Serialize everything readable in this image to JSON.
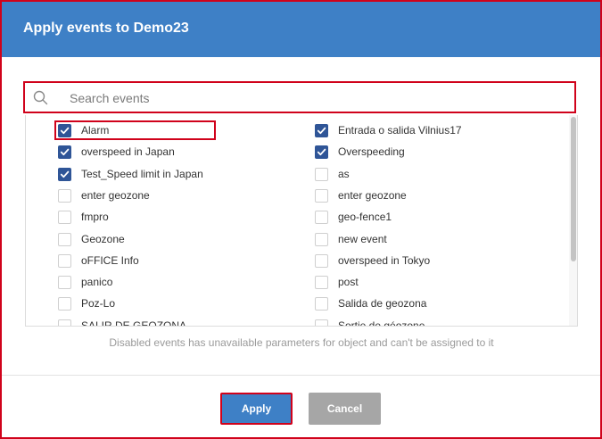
{
  "dialog": {
    "title": "Apply events to Demo23"
  },
  "search": {
    "placeholder": "Search events",
    "value": ""
  },
  "events": {
    "left": [
      {
        "label": "Alarm",
        "checked": true
      },
      {
        "label": "overspeed in Japan",
        "checked": true
      },
      {
        "label": "Test_Speed limit in Japan",
        "checked": true
      },
      {
        "label": "enter geozone",
        "checked": false
      },
      {
        "label": "fmpro",
        "checked": false
      },
      {
        "label": "Geozone",
        "checked": false
      },
      {
        "label": "oFFICE Info",
        "checked": false
      },
      {
        "label": "panico",
        "checked": false
      },
      {
        "label": "Poz-Lo",
        "checked": false
      },
      {
        "label": "SALIR DE GEOZONA",
        "checked": false
      }
    ],
    "right": [
      {
        "label": "Entrada o salida Vilnius17",
        "checked": true
      },
      {
        "label": "Overspeeding",
        "checked": true
      },
      {
        "label": "as",
        "checked": false
      },
      {
        "label": "enter geozone",
        "checked": false
      },
      {
        "label": "geo-fence1",
        "checked": false
      },
      {
        "label": "new event",
        "checked": false
      },
      {
        "label": "overspeed in Tokyo",
        "checked": false
      },
      {
        "label": "post",
        "checked": false
      },
      {
        "label": "Salida de geozona",
        "checked": false
      },
      {
        "label": "Sortie de géozone",
        "checked": false
      }
    ]
  },
  "note": "Disabled events has unavailable parameters for object and can't be assigned to it",
  "buttons": {
    "apply": "Apply",
    "cancel": "Cancel"
  },
  "colors": {
    "header": "#3e80c6",
    "checkbox_checked": "#2f5597",
    "highlight_border": "#d0021b",
    "cancel_button": "#a6a6a6"
  },
  "icons": {
    "search": "search-icon",
    "check": "check-icon"
  }
}
